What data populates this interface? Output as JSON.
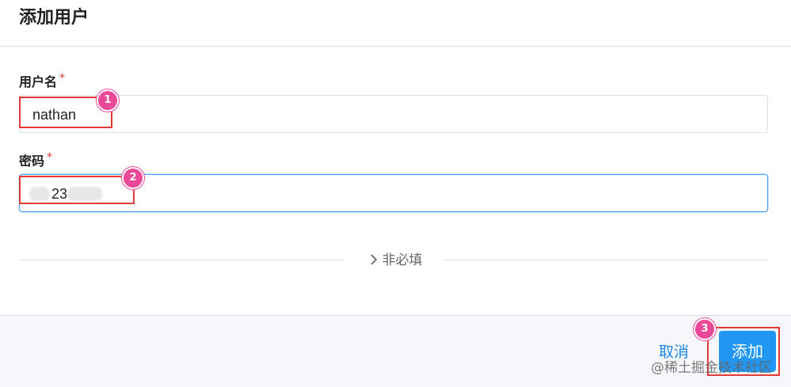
{
  "header": {
    "title": "添加用户"
  },
  "form": {
    "username": {
      "label": "用户名",
      "required_mark": "*",
      "value": "nathan"
    },
    "password": {
      "label": "密码",
      "required_mark": "*",
      "value": "23"
    },
    "optional_toggle": {
      "icon": "chevron-right-icon",
      "label": "非必填"
    }
  },
  "footer": {
    "cancel_label": "取消",
    "add_label": "添加"
  },
  "annotations": [
    "1",
    "2",
    "3"
  ],
  "watermark": "@稀土掘金技术社区",
  "colors": {
    "primary": "#2196f3",
    "annotation_box": "#e53935",
    "annotation_badge": "#ec4899",
    "required": "#e53935"
  }
}
